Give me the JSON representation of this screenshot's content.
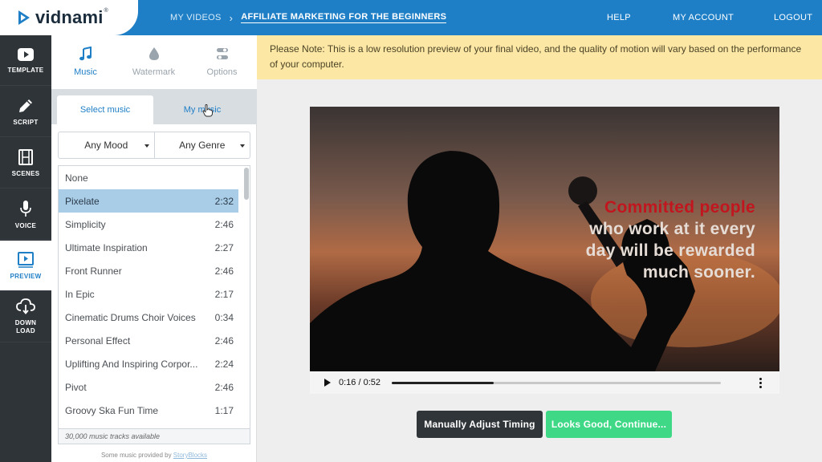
{
  "brand": {
    "name": "vidnami",
    "reg": "®",
    "accent": "#1f7fc6"
  },
  "breadcrumb": {
    "parent": "MY VIDEOS",
    "separator": "›",
    "current": "AFFILIATE MARKETING FOR THE BEGINNERS"
  },
  "topnav": {
    "help": "HELP",
    "account": "MY ACCOUNT",
    "logout": "LOGOUT"
  },
  "rail": [
    {
      "label": "TEMPLATE",
      "icon": "youtube-play-icon"
    },
    {
      "label": "SCRIPT",
      "icon": "pencil-icon"
    },
    {
      "label": "SCENES",
      "icon": "film-icon"
    },
    {
      "label": "VOICE",
      "icon": "microphone-icon"
    },
    {
      "label": "PREVIEW",
      "icon": "preview-play-icon",
      "active": true
    },
    {
      "label1": "DOWN",
      "label2": "LOAD",
      "icon": "cloud-download-icon"
    }
  ],
  "panel_tabs": [
    {
      "label": "Music",
      "icon": "music-note-icon",
      "active": true
    },
    {
      "label": "Watermark",
      "icon": "drop-icon"
    },
    {
      "label": "Options",
      "icon": "toggle-icon"
    }
  ],
  "music_subtabs": {
    "select": "Select music",
    "mine": "My music"
  },
  "filters": {
    "mood": "Any Mood",
    "genre": "Any Genre"
  },
  "tracks": [
    {
      "title": "None",
      "duration": ""
    },
    {
      "title": "Pixelate",
      "duration": "2:32",
      "selected": true
    },
    {
      "title": "Simplicity",
      "duration": "2:46"
    },
    {
      "title": "Ultimate Inspiration",
      "duration": "2:27"
    },
    {
      "title": "Front Runner",
      "duration": "2:46"
    },
    {
      "title": "In Epic",
      "duration": "2:17"
    },
    {
      "title": "Cinematic Drums Choir Voices",
      "duration": "0:34"
    },
    {
      "title": "Personal Effect",
      "duration": "2:46"
    },
    {
      "title": "Uplifting And Inspiring Corpor...",
      "duration": "2:24"
    },
    {
      "title": "Pivot",
      "duration": "2:46"
    },
    {
      "title": "Groovy Ska Fun Time",
      "duration": "1:17"
    }
  ],
  "tracks_available": "30,000 music tracks available",
  "provided_by": {
    "prefix": "Some music provided by",
    "link": "StoryBlocks"
  },
  "notice": "Please Note: This is a low resolution preview of your final video, and the quality of motion will vary based on the performance of your computer.",
  "video": {
    "caption_highlight": "Committed people",
    "caption_lines": [
      "who work at it every",
      "day will be rewarded",
      "much sooner."
    ],
    "time": "0:16 / 0:52",
    "progress": 0.31
  },
  "actions": {
    "adjust": "Manually Adjust Timing",
    "continue": "Looks Good, Continue..."
  }
}
